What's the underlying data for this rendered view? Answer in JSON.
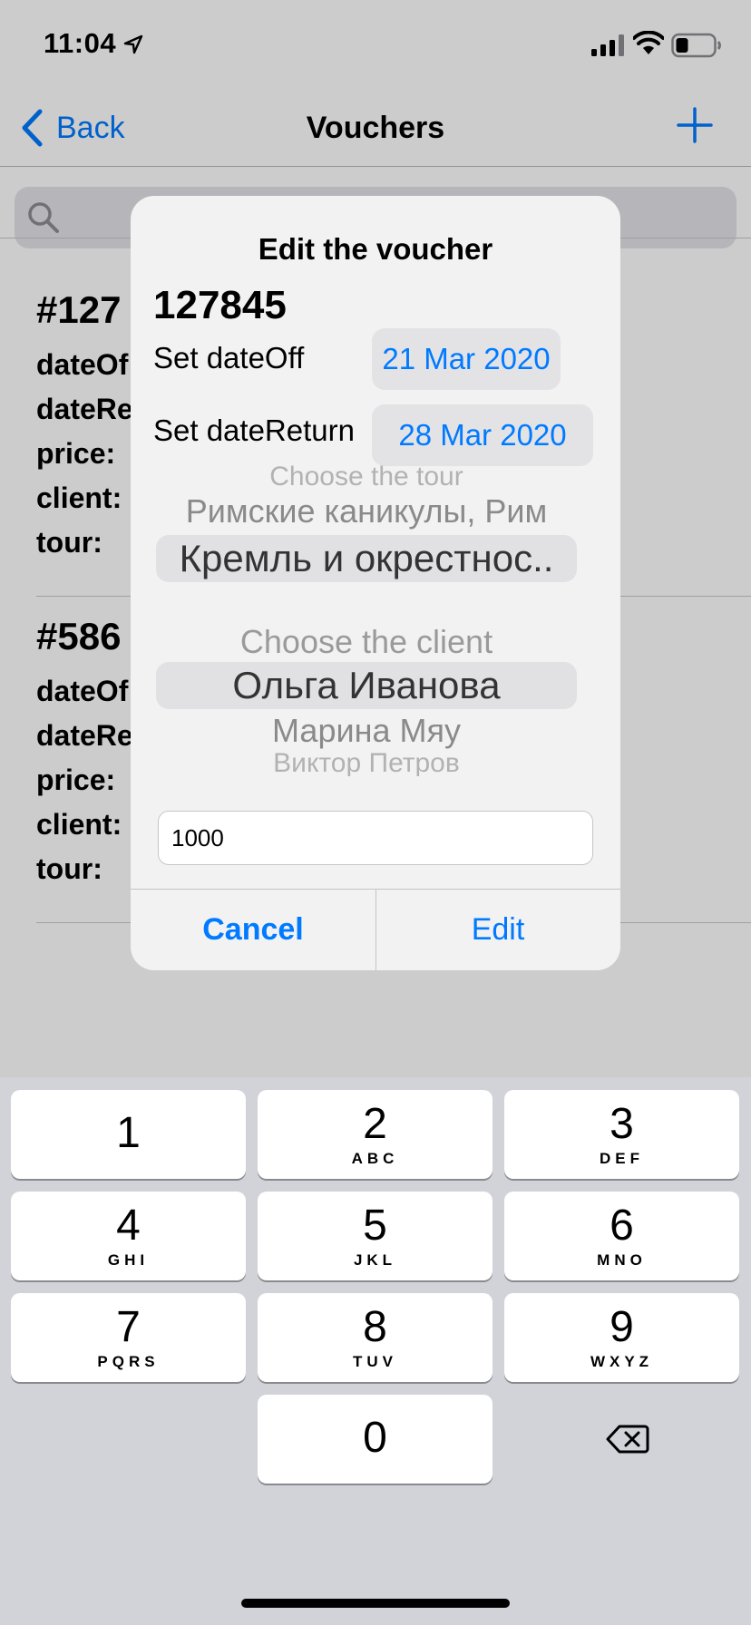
{
  "status": {
    "time": "11:04"
  },
  "nav": {
    "back_label": "Back",
    "title": "Vouchers"
  },
  "vouchers": [
    {
      "id_partial": "#127",
      "rows": [
        "dateOf",
        "dateRe",
        "price:",
        "client:",
        "tour:"
      ]
    },
    {
      "id_partial": "#586",
      "rows": [
        "dateOf",
        "dateRe",
        "price:",
        "client:",
        "tour:"
      ]
    }
  ],
  "alert": {
    "title": "Edit the voucher",
    "voucher_number": "127845",
    "date_off_label": "Set dateOff",
    "date_off_value": "21 Mar 2020",
    "date_return_label": "Set dateReturn",
    "date_return_value": "28 Mar 2020",
    "tour_picker": {
      "placeholder": "Choose the tour",
      "above": "Римские каникулы, Рим",
      "selected": "Кремль и окрестнос.."
    },
    "client_picker": {
      "placeholder": "Choose the client",
      "selected": "Ольга Иванова",
      "below": "Марина Мяу",
      "below2": "Виктор Петров"
    },
    "price_value": "1000",
    "cancel_label": "Cancel",
    "edit_label": "Edit"
  },
  "keypad": {
    "keys": [
      {
        "digit": "1",
        "letters": ""
      },
      {
        "digit": "2",
        "letters": "ABC"
      },
      {
        "digit": "3",
        "letters": "DEF"
      },
      {
        "digit": "4",
        "letters": "GHI"
      },
      {
        "digit": "5",
        "letters": "JKL"
      },
      {
        "digit": "6",
        "letters": "MNO"
      },
      {
        "digit": "7",
        "letters": "PQRS"
      },
      {
        "digit": "8",
        "letters": "TUV"
      },
      {
        "digit": "9",
        "letters": "WXYZ"
      },
      {
        "digit": "0",
        "letters": ""
      }
    ]
  },
  "colors": {
    "accent": "#007aff",
    "keyboard_bg": "#d1d3d9",
    "dim": "rgba(0,0,0,0.2)"
  },
  "icons": [
    "location-arrow-icon",
    "cellular-signal-icon",
    "wifi-icon",
    "battery-icon",
    "chevron-left-icon",
    "plus-icon",
    "search-icon",
    "delete-backspace-icon"
  ]
}
